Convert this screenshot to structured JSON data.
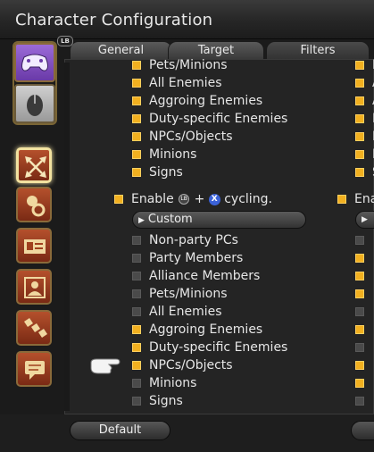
{
  "window": {
    "title": "Character Configuration"
  },
  "tabs": [
    {
      "label": "General"
    },
    {
      "label": "Target"
    },
    {
      "label": "Filters"
    }
  ],
  "lb_badge": "LB",
  "device_buttons": [
    {
      "icon": "gamepad-icon",
      "active": true
    },
    {
      "icon": "mouse-icon",
      "active": false
    }
  ],
  "categories": [
    {
      "icon": "target-arrows-icon",
      "active": true
    },
    {
      "icon": "gear-bag-icon"
    },
    {
      "icon": "id-card-icon"
    },
    {
      "icon": "portrait-icon"
    },
    {
      "icon": "hotbar-icon"
    },
    {
      "icon": "chat-bubble-icon"
    }
  ],
  "list_top": [
    {
      "label": "Pets/Minions",
      "checked": true
    },
    {
      "label": "All Enemies",
      "checked": true
    },
    {
      "label": "Aggroing Enemies",
      "checked": true
    },
    {
      "label": "Duty-specific Enemies",
      "checked": true
    },
    {
      "label": "NPCs/Objects",
      "checked": true
    },
    {
      "label": "Minions",
      "checked": true
    },
    {
      "label": "Signs",
      "checked": true
    }
  ],
  "enable": {
    "prefix": "Enable",
    "lb": "LB",
    "plus": "+",
    "x": "X",
    "suffix": "cycling.",
    "checked": true
  },
  "dropdown": {
    "value": "Custom"
  },
  "list_bottom": [
    {
      "label": "Non-party PCs",
      "checked": false
    },
    {
      "label": "Party Members",
      "checked": false
    },
    {
      "label": "Alliance Members",
      "checked": false
    },
    {
      "label": "Pets/Minions",
      "checked": false
    },
    {
      "label": "All Enemies",
      "checked": false
    },
    {
      "label": "Aggroing Enemies",
      "checked": true
    },
    {
      "label": "Duty-specific Enemies",
      "checked": true
    },
    {
      "label": "NPCs/Objects",
      "checked": true
    },
    {
      "label": "Minions",
      "checked": false
    },
    {
      "label": "Signs",
      "checked": false
    }
  ],
  "right_col": {
    "enable_prefix": "Ena",
    "letters": [
      "P",
      "A",
      "A",
      "D",
      "N",
      "M",
      "S"
    ]
  },
  "footer": {
    "default_label": "Default"
  },
  "colors": {
    "checked": "#f2b020",
    "unchecked": "#4a4a4a",
    "accent_purple": "#8a5ad0",
    "category_red": "#a0401e"
  }
}
